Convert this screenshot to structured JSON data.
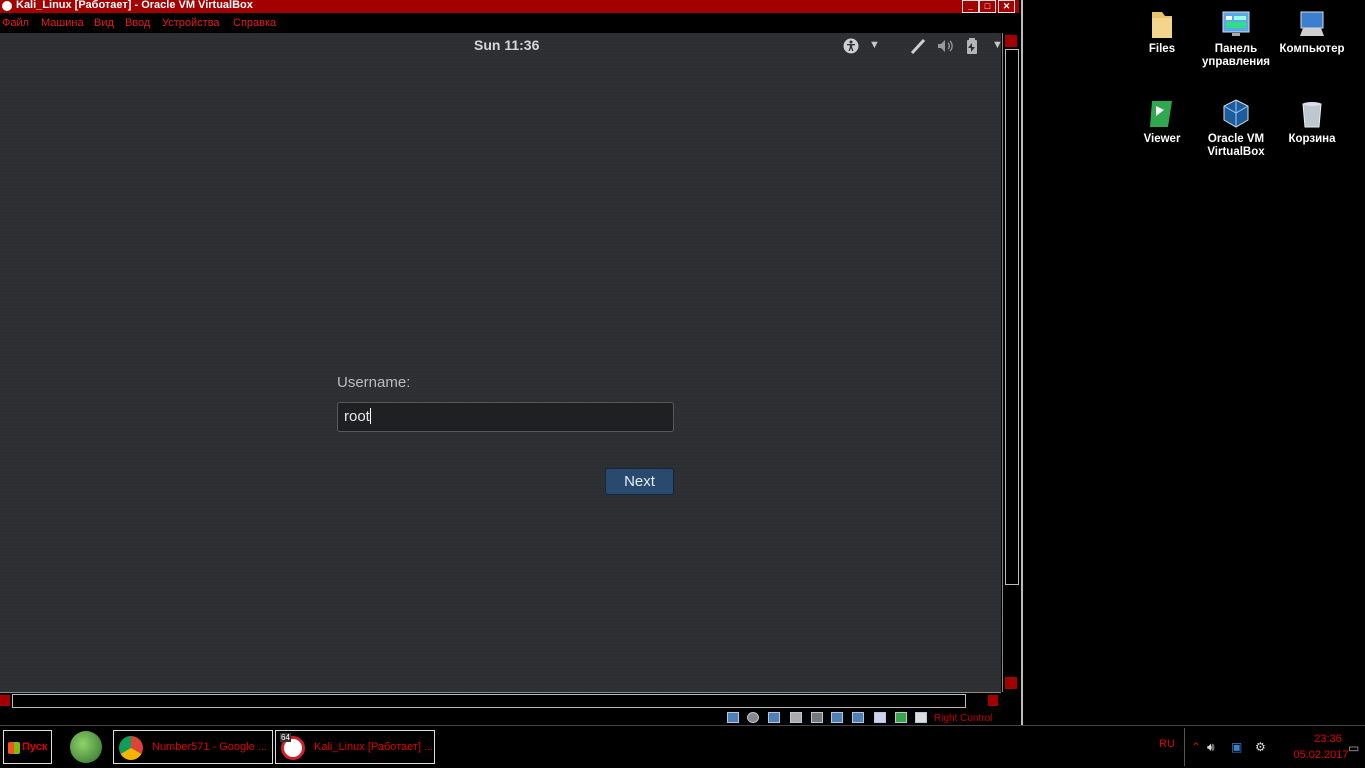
{
  "vbox": {
    "title": "Kali_Linux [Работает] - Oracle VM VirtualBox",
    "menu": [
      "Файл",
      "Машина",
      "Вид",
      "Ввод",
      "Устройства",
      "Справка"
    ],
    "host_key": "Right Control"
  },
  "guest": {
    "clock": "Sun 11:36",
    "topbar_icons": [
      "accessibility-icon",
      "chevron-down-icon",
      "network-icon",
      "volume-icon",
      "battery-icon",
      "chevron-down-icon"
    ],
    "username_label": "Username:",
    "username_value": "root",
    "next_label": "Next"
  },
  "desktop_icons": [
    {
      "label": "Files",
      "icon": "folder-icon"
    },
    {
      "label": "Панель управления",
      "icon": "control-panel-icon"
    },
    {
      "label": "Компьютер",
      "icon": "computer-icon"
    },
    {
      "label": "Viewer",
      "icon": "viewer-icon"
    },
    {
      "label": "Oracle VM VirtualBox",
      "icon": "virtualbox-icon"
    },
    {
      "label": "Корзина",
      "icon": "recycle-bin-icon"
    }
  ],
  "taskbar": {
    "start_label": "Пуск",
    "tasks": [
      {
        "label": "Number571 - Google ...",
        "icon": "chrome-icon"
      },
      {
        "label": "Kali_Linux [Работает] ...",
        "icon": "virtualbox-vm-icon",
        "badge": "64"
      }
    ],
    "lang": "RU",
    "time": "23:36",
    "date": "05.02.2017"
  },
  "colors": {
    "accent_red": "#a30000",
    "guest_bg": "#2c2f32",
    "next_button": "#294a6e"
  }
}
